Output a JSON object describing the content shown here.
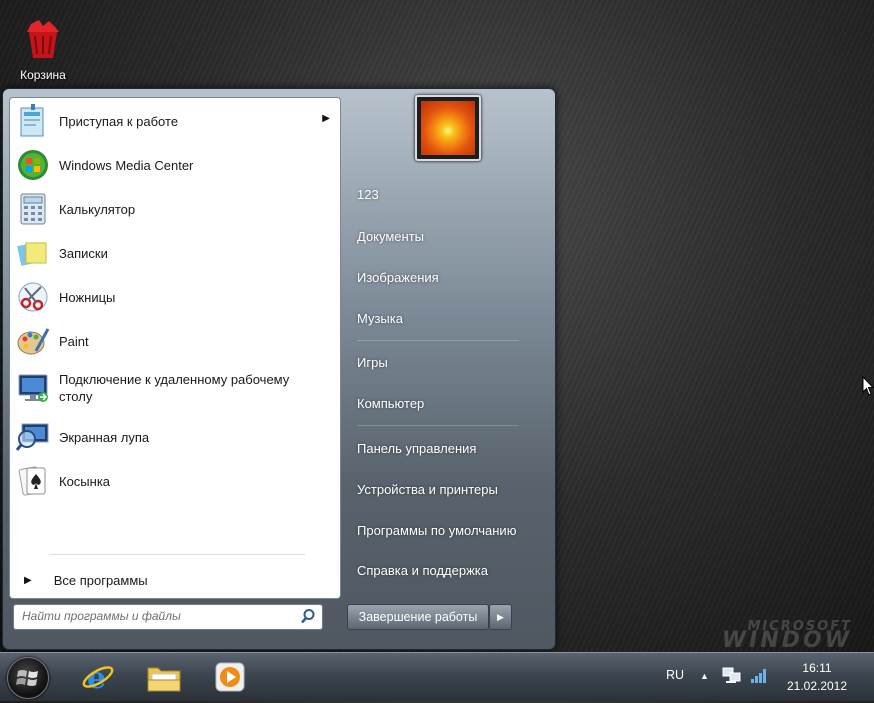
{
  "desktop": {
    "recycle_bin_label": "Корзина",
    "watermark_line1": "MICROSOFT",
    "watermark_line2": "WINDOW"
  },
  "start_menu": {
    "programs": [
      {
        "label": "Приступая к работе",
        "icon": "getting-started-icon",
        "has_submenu": true
      },
      {
        "label": "Windows Media Center",
        "icon": "media-center-icon"
      },
      {
        "label": "Калькулятор",
        "icon": "calculator-icon"
      },
      {
        "label": "Записки",
        "icon": "sticky-notes-icon"
      },
      {
        "label": "Ножницы",
        "icon": "scissors-icon"
      },
      {
        "label": "Paint",
        "icon": "paint-palette-icon"
      },
      {
        "label": "Подключение к удаленному рабочему столу",
        "icon": "remote-desktop-icon"
      },
      {
        "label": "Экранная лупа",
        "icon": "magnifier-icon"
      },
      {
        "label": "Косынка",
        "icon": "solitaire-icon"
      }
    ],
    "all_programs_label": "Все программы",
    "search_placeholder": "Найти программы и файлы",
    "right_items": [
      "123",
      "Документы",
      "Изображения",
      "Музыка",
      "Игры",
      "Компьютер",
      "Панель управления",
      "Устройства и принтеры",
      "Программы по умолчанию",
      "Справка и поддержка"
    ],
    "shutdown_label": "Завершение работы"
  },
  "taskbar": {
    "pinned": [
      "internet-explorer-icon",
      "explorer-folder-icon",
      "media-player-icon"
    ],
    "language": "RU",
    "time": "16:11",
    "date": "21.02.2012"
  }
}
